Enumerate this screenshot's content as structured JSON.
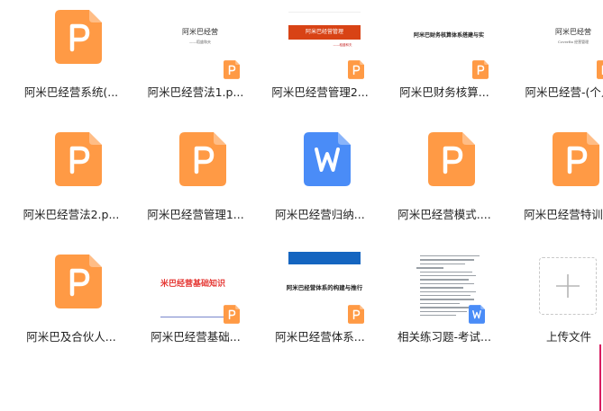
{
  "files": [
    {
      "name": "阿米巴经营系统(...",
      "kind": "ppt-icon"
    },
    {
      "name": "阿米巴经营法1.p...",
      "kind": "ppt-preview",
      "preview_title": "阿米巴经营",
      "preview_sub": "——稻盛和夫"
    },
    {
      "name": "阿米巴经营管理2...",
      "kind": "ppt-preview-red",
      "preview_title": "阿米巴经营管理",
      "preview_sub": "——稻盛和夫"
    },
    {
      "name": "阿米巴财务核算...",
      "kind": "ppt-preview-text",
      "preview_title": "阿米巴财务核算体系搭建与实"
    },
    {
      "name": "阿米巴经营-(个人",
      "kind": "ppt-preview",
      "preview_title": "阿米巴经营",
      "preview_sub": "Coverfix 经营管理"
    },
    {
      "name": "阿米巴经营法2.p...",
      "kind": "ppt-icon"
    },
    {
      "name": "阿米巴经营管理1...",
      "kind": "ppt-icon"
    },
    {
      "name": "阿米巴经营归纳...",
      "kind": "word-icon"
    },
    {
      "name": "阿米巴经营模式....",
      "kind": "ppt-icon"
    },
    {
      "name": "阿米巴经营特训...",
      "kind": "ppt-icon"
    },
    {
      "name": "阿米巴及合伙人...",
      "kind": "ppt-icon"
    },
    {
      "name": "阿米巴经营基础...",
      "kind": "ppt-preview-bold",
      "preview_title": "米巴经营基础知识"
    },
    {
      "name": "阿米巴经营体系...",
      "kind": "ppt-preview-blue",
      "preview_title": "阿米巴经营体系的构建与推行"
    },
    {
      "name": "相关练习题-考试...",
      "kind": "word-preview"
    }
  ],
  "upload": {
    "label": "上传文件"
  },
  "colors": {
    "ppt": "#FF9A45",
    "word": "#4A8CF7",
    "accent_red": "#D84315",
    "upload_border": "#C8C8C8"
  }
}
